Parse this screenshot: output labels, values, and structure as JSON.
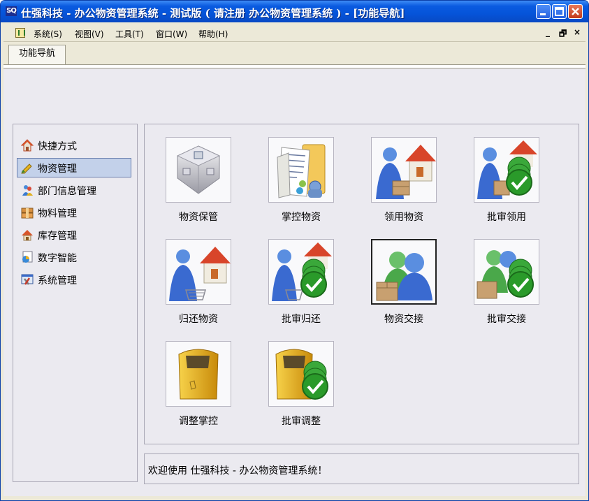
{
  "window": {
    "app_icon": "SQ",
    "title": "仕强科技 - 办公物资管理系统 - 测试版 ( 请注册 办公物资管理系统 ) - [功能导航]",
    "controls": [
      "minimize-icon",
      "maximize-icon",
      "close-icon"
    ]
  },
  "menubar": {
    "items": [
      {
        "label": "系统(S)"
      },
      {
        "label": "视图(V)"
      },
      {
        "label": "工具(T)"
      },
      {
        "label": "窗口(W)"
      },
      {
        "label": "帮助(H)"
      }
    ],
    "mdi_minimize": "_",
    "mdi_restore": "🗗",
    "mdi_close": "×"
  },
  "tabs": [
    {
      "label": "功能导航"
    }
  ],
  "sidebar": {
    "items": [
      {
        "label": "快捷方式",
        "icon": "house-icon"
      },
      {
        "label": "物资管理",
        "icon": "pen-icon",
        "active": true
      },
      {
        "label": "部门信息管理",
        "icon": "people-icon"
      },
      {
        "label": "物料管理",
        "icon": "box-icon"
      },
      {
        "label": "库存管理",
        "icon": "roof-icon"
      },
      {
        "label": "数字智能",
        "icon": "chart-icon"
      },
      {
        "label": "系统管理",
        "icon": "tools-icon"
      }
    ]
  },
  "tiles": [
    {
      "label": "物资保管",
      "icon": "storage-icon"
    },
    {
      "label": "掌控物资",
      "icon": "documents-icon"
    },
    {
      "label": "领用物资",
      "icon": "person-house-icon"
    },
    {
      "label": "批审领用",
      "icon": "person-house-check-icon"
    },
    {
      "label": "归还物资",
      "icon": "person-house-cart-icon"
    },
    {
      "label": "批审归还",
      "icon": "person-house-check-icon"
    },
    {
      "label": "物资交接",
      "icon": "people-box-icon",
      "selected": true
    },
    {
      "label": "批审交接",
      "icon": "people-box-check-icon"
    },
    {
      "label": "调整掌控",
      "icon": "yellow-bin-icon"
    },
    {
      "label": "批审调整",
      "icon": "yellow-bin-check-icon"
    }
  ],
  "status": {
    "message": "欢迎使用 仕强科技 - 办公物资管理系统！"
  }
}
